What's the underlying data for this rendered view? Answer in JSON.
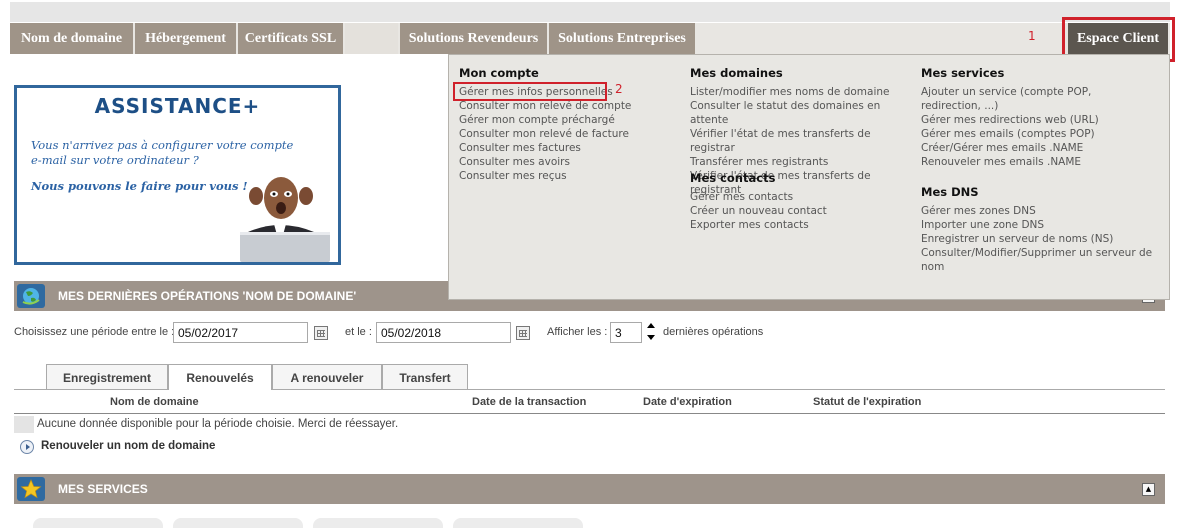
{
  "nav": {
    "tabs": [
      {
        "label": "Nom de domaine"
      },
      {
        "label": "Hébergement"
      },
      {
        "label": "Certificats SSL"
      },
      {
        "label": ""
      },
      {
        "label": "Solutions Revendeurs"
      },
      {
        "label": "Solutions Entreprises"
      }
    ],
    "espace_client": "Espace Client",
    "annotation_1": "1"
  },
  "menu": {
    "annotation_2": "2",
    "mon_compte": {
      "title": "Mon compte",
      "items": [
        "Gérer mes infos personnelles",
        "Consulter mon relevé de compte",
        "Gérer mon compte préchargé",
        "Consulter mon relevé de facture",
        "Consulter mes factures",
        "Consulter mes avoirs",
        "Consulter mes reçus"
      ]
    },
    "mes_domaines": {
      "title": "Mes domaines",
      "items": [
        "Lister/modifier mes noms de domaine",
        "Consulter le statut des domaines en attente",
        "Vérifier l'état de mes transferts de registrar",
        "Transférer mes registrants",
        "Vérifier l'état de mes transferts de registrant"
      ]
    },
    "mes_contacts": {
      "title": "Mes contacts",
      "items": [
        "Gérer mes contacts",
        "Créer un nouveau contact",
        "Exporter mes contacts"
      ]
    },
    "mes_services": {
      "title": "Mes services",
      "items": [
        "Ajouter un service (compte POP, redirection, ...)",
        "Gérer mes redirections web (URL)",
        "Gérer mes emails (comptes POP)",
        "Créer/Gérer mes emails .NAME",
        "Renouveler mes emails .NAME"
      ]
    },
    "mes_dns": {
      "title": "Mes DNS",
      "items": [
        "Gérer mes zones DNS",
        "Importer une zone DNS",
        "Enregistrer un serveur de noms (NS)",
        "Consulter/Modifier/Supprimer un serveur de nom"
      ]
    }
  },
  "banner": {
    "title": "ASSISTANCE+",
    "line1": "Vous n'arrivez pas à configurer votre  compte",
    "line2": "e-mail sur votre ordinateur ?",
    "line3": "Nous pouvons le faire pour vous !"
  },
  "operations": {
    "title": "MES DERNIÈRES OPÉRATIONS 'NOM DE DOMAINE'",
    "period_label": "Choisissez une période entre le :",
    "date_from": "05/02/2017",
    "and_label": "et le :",
    "date_to": "05/02/2018",
    "show_label": "Afficher les :",
    "count": "3",
    "last_ops_label": "dernières opérations",
    "tabs": [
      "Enregistrement",
      "Renouvelés",
      "A renouveler",
      "Transfert"
    ],
    "active_tab": "Renouvelés",
    "columns": [
      "Nom de domaine",
      "Date de la transaction",
      "Date d'expiration",
      "Statut de l'expiration"
    ],
    "empty_message": "Aucune donnée disponible pour la période choisie. Merci de réessayer.",
    "renew_link": "Renouveler un nom de domaine"
  },
  "services": {
    "title": "MES SERVICES"
  },
  "colors": {
    "nav_tab": "#9f9488",
    "espace_client": "#5b564f",
    "highlight": "#d0212b",
    "banner_border": "#31679c",
    "section_bar": "#9e948b"
  }
}
